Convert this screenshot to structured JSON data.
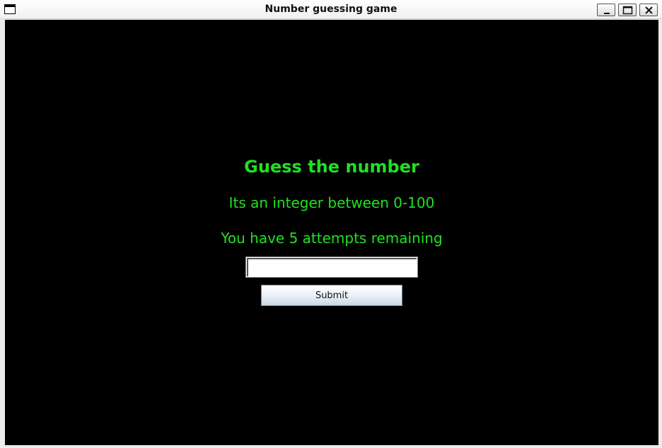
{
  "window": {
    "title": "Number guessing game",
    "icon": "window-icon",
    "controls": [
      "minimize-icon",
      "maximize-icon",
      "close-icon"
    ]
  },
  "game": {
    "heading": "Guess the number",
    "range_text": "Its an integer between 0-100",
    "attempts_text": "You have 5 attempts remaining",
    "guess_value": "",
    "submit_label": "Submit"
  },
  "colors": {
    "background": "#000000",
    "text_accent": "#22e022"
  }
}
